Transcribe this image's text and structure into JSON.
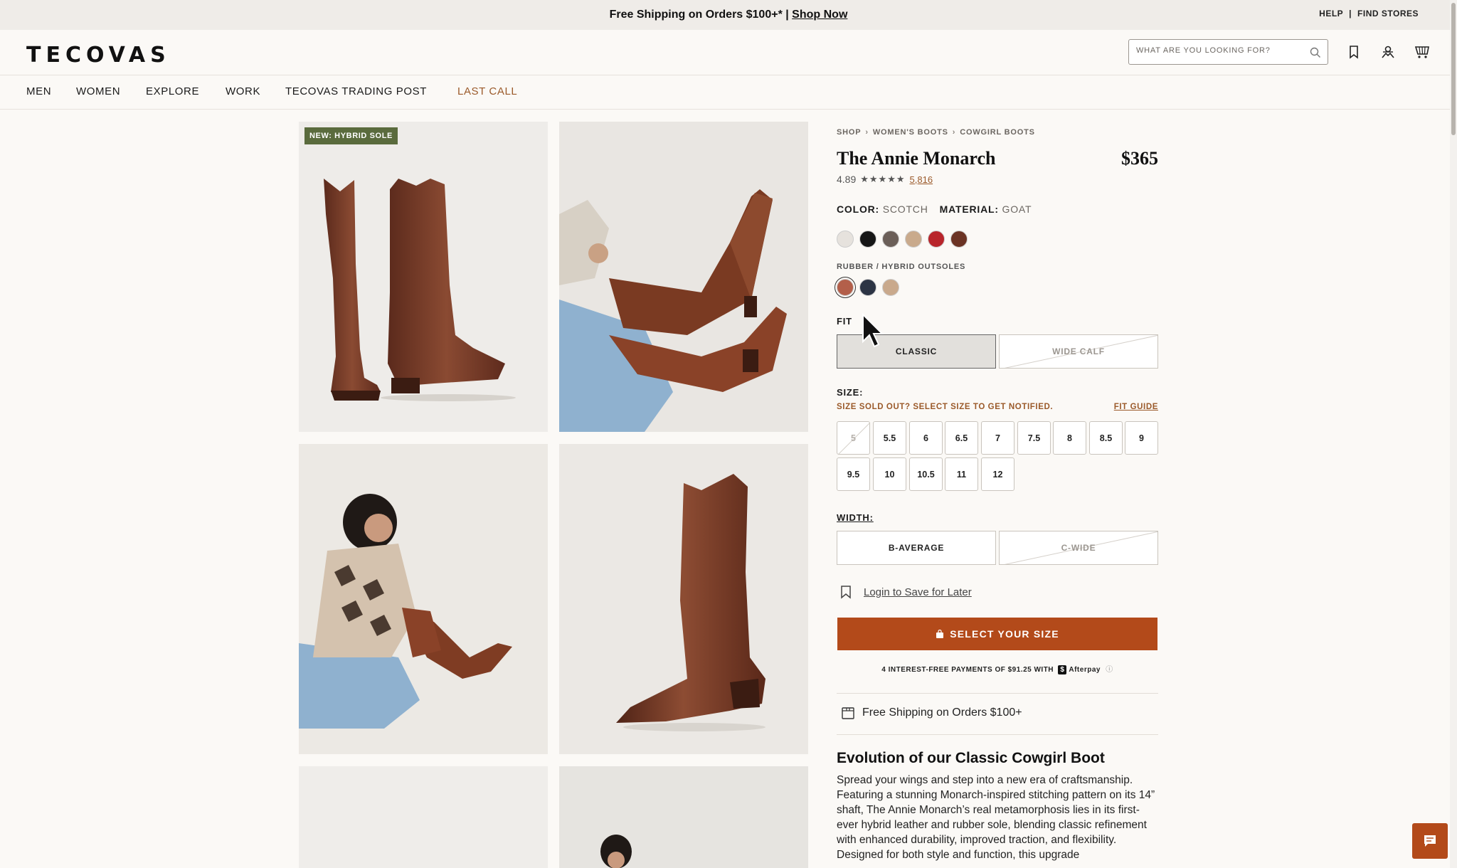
{
  "announcement": {
    "text": "Free Shipping on Orders $100+* | ",
    "link": "Shop Now",
    "help": "HELP",
    "sep": "|",
    "find_stores": "FIND STORES"
  },
  "header": {
    "logo": "TECOVAS",
    "search_placeholder": "WHAT ARE YOU LOOKING FOR?"
  },
  "nav": {
    "items": [
      "MEN",
      "WOMEN",
      "EXPLORE",
      "WORK",
      "TECOVAS TRADING POST",
      "LAST CALL"
    ]
  },
  "gallery": {
    "badge": "NEW: HYBRID SOLE"
  },
  "product": {
    "breadcrumbs": [
      "SHOP",
      "WOMEN'S BOOTS",
      "COWGIRL BOOTS"
    ],
    "title": "The Annie Monarch",
    "price": "$365",
    "rating": "4.89",
    "stars": "★★★★★",
    "review_count": "5,816",
    "color_label": "COLOR:",
    "color_value": "SCOTCH",
    "material_label": "MATERIAL:",
    "material_value": "GOAT",
    "color_swatches": [
      "#e6e2dd",
      "#161616",
      "#6b5f58",
      "#c9aa8c",
      "#b8252b",
      "#6b3324"
    ],
    "outsole_label": "RUBBER / HYBRID OUTSOLES",
    "outsole_swatches": [
      "#b35f4a",
      "#2c3444",
      "#c9a98c"
    ],
    "fit_label": "FIT",
    "fit_options": [
      "CLASSIC",
      "WIDE CALF"
    ],
    "size_label": "SIZE:",
    "size_notice": "SIZE SOLD OUT? SELECT SIZE TO GET NOTIFIED.",
    "fit_guide": "FIT GUIDE",
    "sizes": [
      "5",
      "5.5",
      "6",
      "6.5",
      "7",
      "7.5",
      "8",
      "8.5",
      "9",
      "9.5",
      "10",
      "10.5",
      "11",
      "12"
    ],
    "width_label": "WIDTH:",
    "width_options": [
      "B-AVERAGE",
      "C-WIDE"
    ],
    "save_later": "Login to Save for Later",
    "cta": "SELECT YOUR SIZE",
    "afterpay_text": "4 INTEREST-FREE PAYMENTS OF $91.25 WITH",
    "afterpay_brand": "Afterpay",
    "afterpay_info": "ⓘ",
    "shipping": "Free Shipping on Orders $100+",
    "evolution_title": "Evolution of our Classic Cowgirl Boot",
    "evolution_body": "Spread your wings and step into a new era of craftsmanship. Featuring a stunning Monarch-inspired stitching pattern on its 14” shaft, The Annie Monarch’s real metamorphosis lies in its first-ever hybrid leather and rubber sole, blending classic refinement with enhanced durability, improved traction, and flexibility. Designed for both style and function, this upgrade"
  },
  "colors": {
    "accent": "#b34a1a",
    "link": "#9b5a2a",
    "badge": "#5a6b3d"
  }
}
